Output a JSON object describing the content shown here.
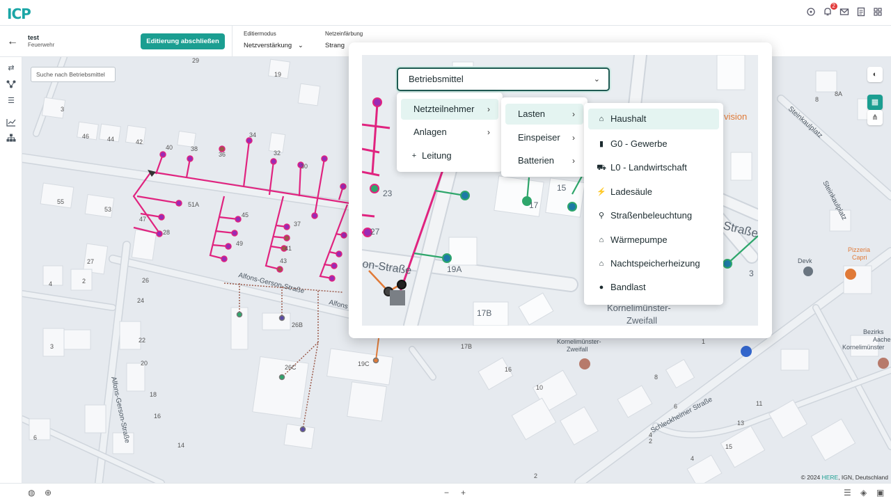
{
  "header": {
    "logo": "ICP",
    "notification_count": "2"
  },
  "toolbar": {
    "project_name": "test",
    "project_subtitle": "Feuerwehr",
    "finish_button": "Editierung abschließen",
    "edit_mode_label": "Editiermodus",
    "edit_mode_value": "Netzverstärkung",
    "coloring_label": "Netzeinfärbung",
    "coloring_value": "Strang"
  },
  "map": {
    "search_placeholder": "Suche nach Betriebsmittel",
    "attribution_prefix": "© 2024 ",
    "attribution_brand": "HERE",
    "attribution_suffix": ", IGN, Deutschland",
    "street_labels": [
      "Alfons-Gerson-Straße",
      "Alfons",
      "Alfons-Gerson-Straße",
      "Schleckheimer Straße",
      "Steinkaulplatz",
      "Steinkaulplatz",
      "Kornelimünster-Zweifall",
      "Pizzeria Capri",
      "Devk",
      "Bezirks Aache Kornelimünster"
    ],
    "house_numbers": [
      "29",
      "19",
      "3",
      "46",
      "44",
      "42",
      "40",
      "38",
      "36",
      "34",
      "32",
      "30",
      "55",
      "53",
      "51A",
      "47",
      "28",
      "45",
      "49",
      "37",
      "39",
      "41",
      "43",
      "31",
      "35",
      "33",
      "27",
      "4",
      "2",
      "26",
      "24",
      "26B",
      "26C",
      "3",
      "22",
      "20",
      "18",
      "16",
      "6",
      "14",
      "17B",
      "19C",
      "16",
      "10",
      "8",
      "6",
      "4",
      "2",
      "13",
      "15",
      "11",
      "8",
      "8A",
      "3",
      "1"
    ]
  },
  "overlay": {
    "select_value": "Betriebsmittel",
    "menu1": [
      "Netzteilnehmer",
      "Anlagen",
      "Leitung"
    ],
    "menu2": [
      "Lasten",
      "Einspeiser",
      "Batterien"
    ],
    "menu3": [
      "Haushalt",
      "G0 - Gewerbe",
      "L0 - Landwirtschaft",
      "Ladesäule",
      "Straßenbeleuchtung",
      "Wärmepumpe",
      "Nachtspeicherheizung",
      "Bandlast"
    ],
    "inset_labels": [
      "23",
      "27",
      "15",
      "17",
      "19A",
      "17B",
      "Kornelimünster-Zweifall",
      "vision",
      "Straße",
      "on-Straße",
      "8A",
      "3"
    ]
  },
  "colors": {
    "accent": "#1b9e91",
    "line_magenta": "#e0237f",
    "line_green": "#2ea66b",
    "line_orange": "#e07a38",
    "line_brown": "#9b5a4a"
  }
}
